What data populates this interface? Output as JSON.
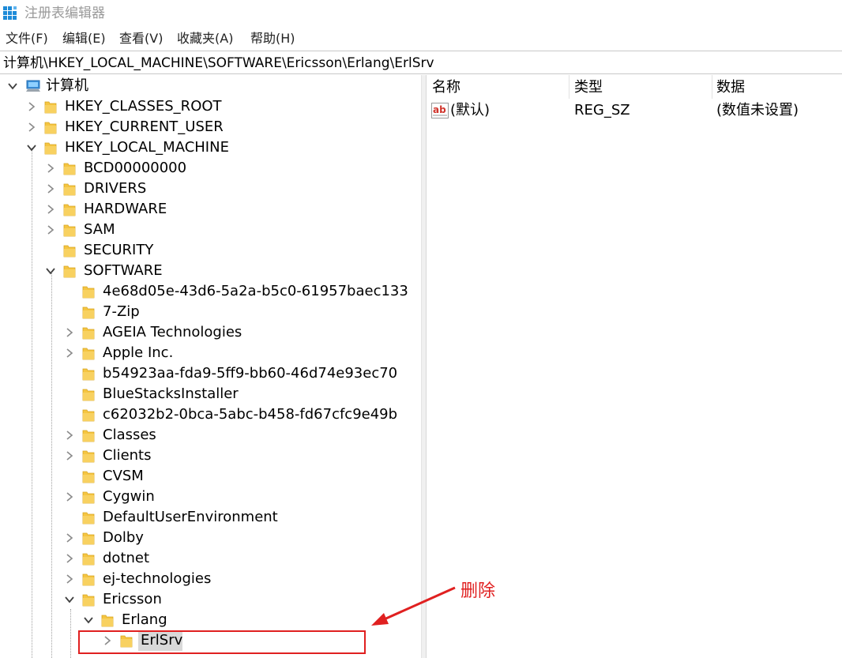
{
  "window": {
    "title": "注册表编辑器"
  },
  "menu": [
    "文件(F)",
    "编辑(E)",
    "查看(V)",
    "收藏夹(A)",
    "帮助(H)"
  ],
  "address": "计算机\\HKEY_LOCAL_MACHINE\\SOFTWARE\\Ericsson\\Erlang\\ErlSrv",
  "tree": {
    "root": "计算机",
    "hives": [
      "HKEY_CLASSES_ROOT",
      "HKEY_CURRENT_USER",
      "HKEY_LOCAL_MACHINE"
    ],
    "hklm_children": [
      "BCD00000000",
      "DRIVERS",
      "HARDWARE",
      "SAM",
      "SECURITY",
      "SOFTWARE"
    ],
    "software_children": [
      "4e68d05e-43d6-5a2a-b5c0-61957baec133",
      "7-Zip",
      "AGEIA Technologies",
      "Apple Inc.",
      "b54923aa-fda9-5ff9-bb60-46d74e93ec70",
      "BlueStacksInstaller",
      "c62032b2-0bca-5abc-b458-fd67cfc9e49b",
      "Classes",
      "Clients",
      "CVSM",
      "Cygwin",
      "DefaultUserEnvironment",
      "Dolby",
      "dotnet",
      "ej-technologies",
      "Ericsson"
    ],
    "erlang": "Erlang",
    "selected": "ErlSrv"
  },
  "list": {
    "headers": {
      "name": "名称",
      "type": "类型",
      "data": "数据"
    },
    "rows": [
      {
        "name": "(默认)",
        "type": "REG_SZ",
        "data": "(数值未设置)"
      }
    ]
  },
  "annotation": {
    "text": "删除",
    "color": "#e02020"
  },
  "colors": {
    "folder": "#f5c542",
    "annotation": "#e02020",
    "selection": "#d9d9d9"
  }
}
